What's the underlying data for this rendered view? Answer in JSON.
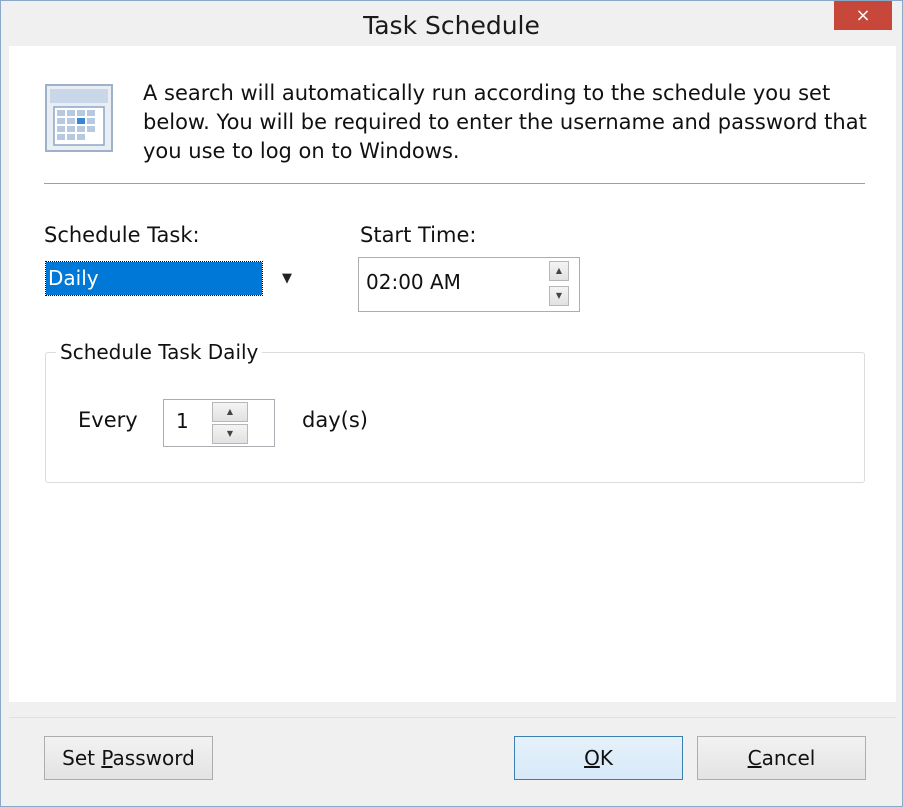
{
  "window": {
    "title": "Task Schedule",
    "close_glyph": "×"
  },
  "info": {
    "icon": "calendar-icon",
    "text": "A search will automatically run according to the schedule you set below.  You will be required to enter the username and password that you use to log on to Windows."
  },
  "schedule": {
    "label": "Schedule Task:",
    "selected": "Daily"
  },
  "start_time": {
    "label": "Start Time:",
    "value": "02:00 AM"
  },
  "daily_group": {
    "title": "Schedule Task Daily",
    "every_label": "Every",
    "every_value": "1",
    "unit_label": "day(s)"
  },
  "buttons": {
    "set_password": {
      "pre": "Set ",
      "mnemonic": "P",
      "post": "assword"
    },
    "ok": {
      "pre": "",
      "mnemonic": "O",
      "post": "K"
    },
    "cancel": {
      "pre": "",
      "mnemonic": "C",
      "post": "ancel"
    }
  },
  "colors": {
    "selection": "#0078d7",
    "close": "#c7473a",
    "default_border": "#3c7fb1"
  }
}
